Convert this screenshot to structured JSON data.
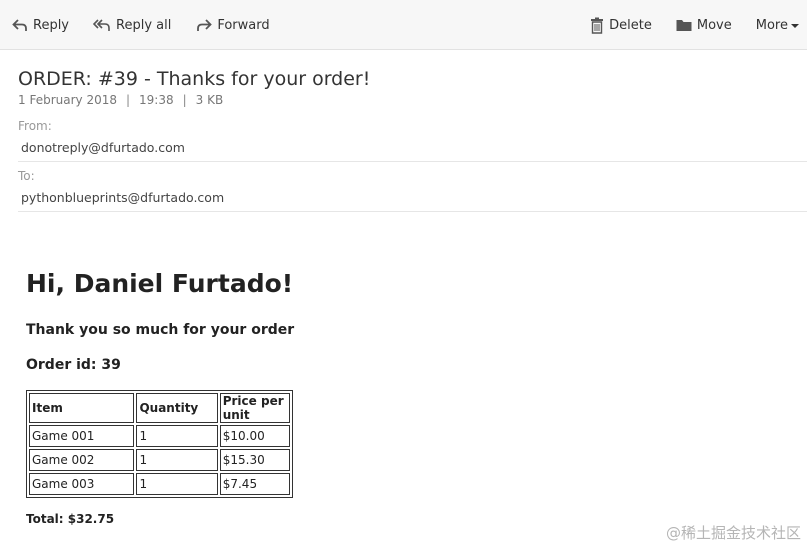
{
  "toolbar": {
    "reply": "Reply",
    "reply_all": "Reply all",
    "forward": "Forward",
    "delete": "Delete",
    "move": "Move",
    "more": "More"
  },
  "message": {
    "subject": "ORDER: #39 - Thanks for your order!",
    "date": "1 February 2018",
    "time": "19:38",
    "size": "3 KB",
    "from_label": "From:",
    "from": "donotreply@dfurtado.com",
    "to_label": "To:",
    "to": "pythonblueprints@dfurtado.com"
  },
  "body": {
    "greeting": "Hi, Daniel Furtado!",
    "thanks": "Thank you so much for your order",
    "order_id": "Order id: 39",
    "table": {
      "headers": [
        "Item",
        "Quantity",
        "Price per unit"
      ],
      "rows": [
        [
          "Game 001",
          "1",
          "$10.00"
        ],
        [
          "Game 002",
          "1",
          "$15.30"
        ],
        [
          "Game 003",
          "1",
          "$7.45"
        ]
      ]
    },
    "total": "Total: $32.75"
  },
  "watermark": "@稀土掘金技术社区"
}
